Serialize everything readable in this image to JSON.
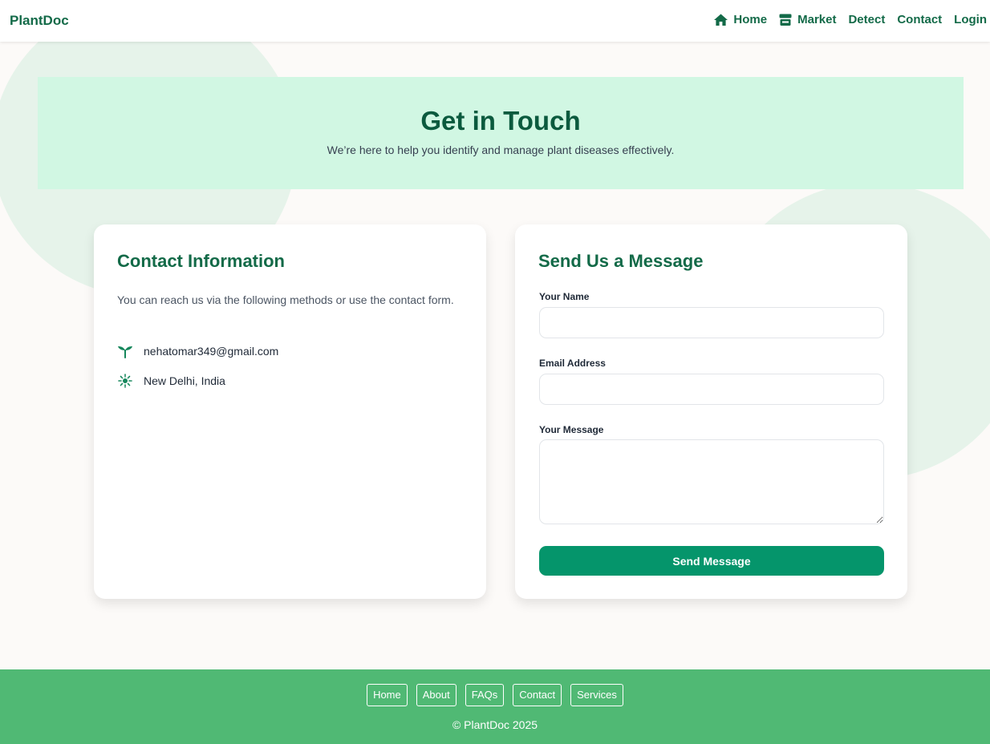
{
  "navbar": {
    "brand": "PlantDoc",
    "links": [
      {
        "label": "Home",
        "icon": "home-icon"
      },
      {
        "label": "Market",
        "icon": "store-icon"
      },
      {
        "label": "Detect"
      },
      {
        "label": "Contact"
      },
      {
        "label": "Login"
      }
    ]
  },
  "hero": {
    "title": "Get in Touch",
    "subtitle": "We’re here to help you identify and manage plant diseases effectively."
  },
  "contact_info": {
    "title": "Contact Information",
    "description": "You can reach us via the following methods or use the contact form.",
    "email": "nehatomar349@gmail.com",
    "location": "New Delhi, India"
  },
  "form": {
    "title": "Send Us a Message",
    "name_label": "Your Name",
    "name_value": "",
    "email_label": "Email Address",
    "email_value": "",
    "message_label": "Your Message",
    "message_value": "",
    "submit_label": "Send Message"
  },
  "footer": {
    "links": [
      "Home",
      "About",
      "FAQs",
      "Contact",
      "Services"
    ],
    "copyright": "© PlantDoc 2025"
  },
  "colors": {
    "brand": "#136a48",
    "hero_bg": "#d1f7e3",
    "button": "#05956b",
    "footer_bg": "#50b974",
    "page_bg": "#fcfaf8"
  }
}
